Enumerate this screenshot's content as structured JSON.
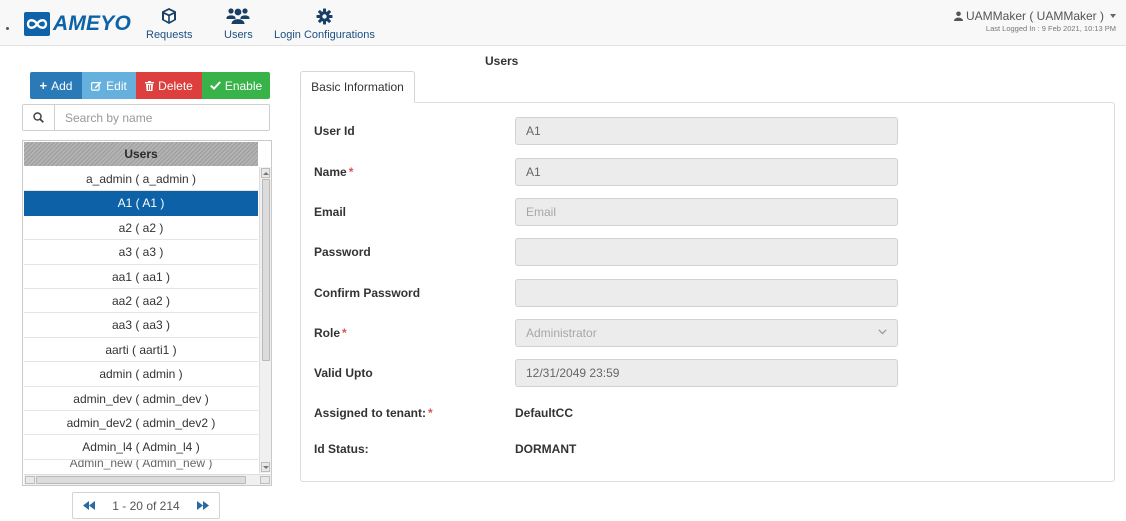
{
  "brand": {
    "logo_text": "AMEYO",
    "logo_color": "#0d62a8"
  },
  "nav": {
    "items": [
      {
        "label": "Requests",
        "icon": "cube-icon"
      },
      {
        "label": "Users",
        "icon": "users-icon"
      },
      {
        "label": "Login Configurations",
        "icon": "gear-icon"
      }
    ],
    "user": {
      "name": "UAMMaker ( UAMMaker )",
      "last_logged": "Last Logged In : 9 Feb 2021, 10:13 PM"
    }
  },
  "page": {
    "title": "Users"
  },
  "toolbar": {
    "add_label": "Add",
    "edit_label": "Edit",
    "delete_label": "Delete",
    "enable_label": "Enable"
  },
  "search": {
    "placeholder": "Search by name"
  },
  "user_list": {
    "header": "Users",
    "items": [
      "a_admin ( a_admin )",
      "A1 ( A1 )",
      "a2 ( a2 )",
      "a3 ( a3 )",
      "aa1 ( aa1 )",
      "aa2 ( aa2 )",
      "aa3 ( aa3 )",
      "aarti ( aarti1 )",
      "admin ( admin )",
      "admin_dev ( admin_dev )",
      "admin_dev2 ( admin_dev2 )",
      "Admin_l4 ( Admin_l4 )",
      "Admin_new ( Admin_new )"
    ],
    "selected_index": 1
  },
  "pagination": {
    "text": "1 - 20 of 214"
  },
  "details": {
    "tab_label": "Basic Information",
    "fields": {
      "user_id": {
        "label": "User Id",
        "value": "A1"
      },
      "name": {
        "label": "Name",
        "value": "A1"
      },
      "email": {
        "label": "Email",
        "placeholder": "Email"
      },
      "password": {
        "label": "Password",
        "value": ""
      },
      "confirm_password": {
        "label": "Confirm Password",
        "value": ""
      },
      "role": {
        "label": "Role",
        "value": "Administrator"
      },
      "valid_upto": {
        "label": "Valid Upto",
        "value": "12/31/2049 23:59"
      },
      "tenant": {
        "label": "Assigned to tenant:",
        "value": "DefaultCC"
      },
      "id_status": {
        "label": "Id Status:",
        "value": "DORMANT"
      }
    },
    "required_marker": "*"
  },
  "colors": {
    "primary": "#0d61a6",
    "add": "#2a7ab8",
    "edit": "#66b0de",
    "delete": "#dc3f3d",
    "enable": "#37b34a",
    "required": "#d9534f"
  }
}
